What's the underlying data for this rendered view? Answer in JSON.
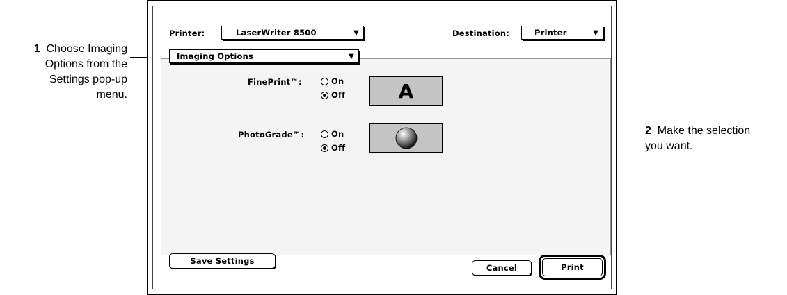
{
  "callouts": {
    "step1_number": "1",
    "step1_text_line1": "Choose Imaging",
    "step1_text_line2": "Options from the",
    "step1_text_line3": "Settings pop-up",
    "step1_text_line4": "menu.",
    "step2_number": "2",
    "step2_text_line1": "Make the selection",
    "step2_text_line2": "you want."
  },
  "dialog": {
    "printer_label": "Printer:",
    "printer_value": "LaserWriter 8500",
    "destination_label": "Destination:",
    "destination_value": "Printer",
    "settings_value": "Imaging Options",
    "fineprint": {
      "label": "FinePrint™:",
      "on_label": "On",
      "off_label": "Off",
      "selected": "Off",
      "preview_glyph": "A"
    },
    "photograde": {
      "label": "PhotoGrade™:",
      "on_label": "On",
      "off_label": "Off",
      "selected": "Off"
    },
    "save_settings_label": "Save Settings",
    "cancel_label": "Cancel",
    "print_label": "Print"
  },
  "icons": {
    "popup_arrow": "triangle-down-icon",
    "photograde_preview": "sphere-icon"
  }
}
